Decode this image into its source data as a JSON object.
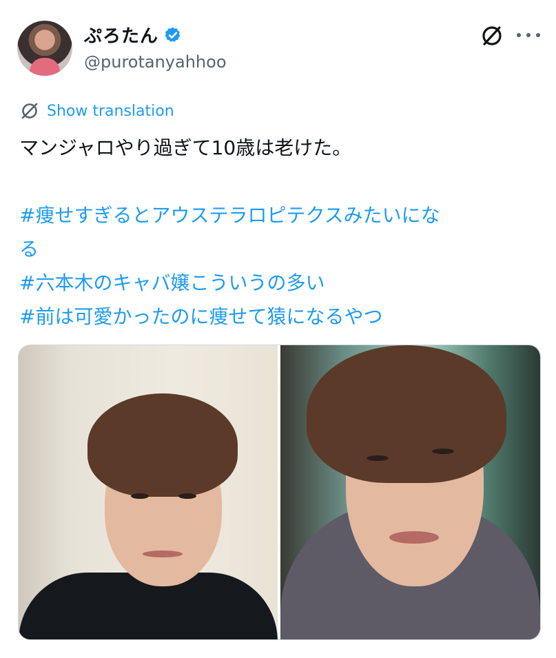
{
  "user": {
    "display_name": "ぷろたん",
    "handle": "@purotanyahhoo",
    "verified": true,
    "verified_color": "#1d9bf0"
  },
  "header_icons": [
    "grok-icon",
    "more-icon"
  ],
  "translation": {
    "label": "Show translation",
    "icon": "globe-translate-icon"
  },
  "tweet": {
    "line1": "マンジャロやり過ぎて10歳は老けた。",
    "hashtags": [
      "#痩せすぎるとアウステラロピテクスみたいにな",
      "る",
      "#六本木のキャバ嬢こういうの多い",
      "#前は可愛かったのに痩せて猿になるやつ"
    ]
  },
  "colors": {
    "link": "#1d9bf0",
    "text": "#0f1419",
    "secondary": "#536471",
    "border": "#cfd9de"
  }
}
